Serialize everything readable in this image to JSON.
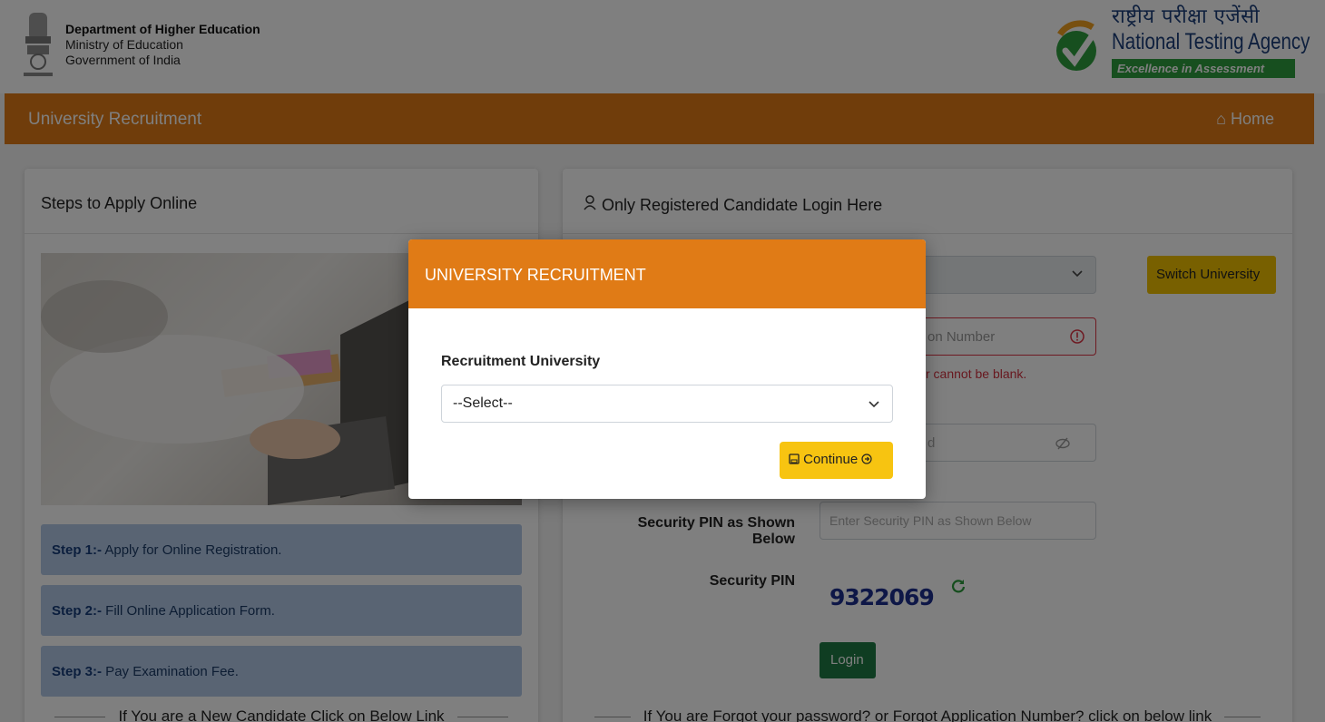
{
  "header": {
    "dept_line1": "Department of Higher Education",
    "dept_line2": "Ministry of Education",
    "dept_line3": "Government of India",
    "nta_hindi": "राष्ट्रीय परीक्षा एजेंसी",
    "nta_english": "National Testing Agency",
    "nta_tagline": "Excellence in Assessment"
  },
  "nav": {
    "title": "University Recruitment",
    "home": "Home"
  },
  "left_card": {
    "title": "Steps to Apply Online",
    "steps": [
      {
        "prefix": "Step 1:-",
        "text": " Apply for Online Registration."
      },
      {
        "prefix": "Step 2:-",
        "text": " Fill Online Application Form."
      },
      {
        "prefix": "Step 3:-",
        "text": " Pay Examination Fee."
      }
    ],
    "new_candidate": "If You are a New Candidate Click on Below Link"
  },
  "right_card": {
    "title": "Only Registered Candidate Login Here",
    "switch_button": "Switch University",
    "app_number_placeholder": "on Number",
    "app_number_error": "r cannot be blank.",
    "password_placeholder": "d",
    "security_pin_label": "Security PIN as Shown Below",
    "security_pin_placeholder": "Enter Security PIN as Shown Below",
    "security_pin_caption": "Security PIN",
    "captcha": "9322069",
    "login_button": "Login",
    "forgot_text": "If You are Forgot your password? or Forgot Application Number? click on below link"
  },
  "modal": {
    "title": "UNIVERSITY RECRUITMENT",
    "field_label": "Recruitment University",
    "select_value": "--Select--",
    "continue_button": "Continue"
  },
  "colors": {
    "primary_orange": "#e07b16",
    "button_yellow": "#f7c411",
    "login_green": "#1f7a44",
    "step_blue": "#b3c9e6",
    "error_red": "#dc3545"
  }
}
